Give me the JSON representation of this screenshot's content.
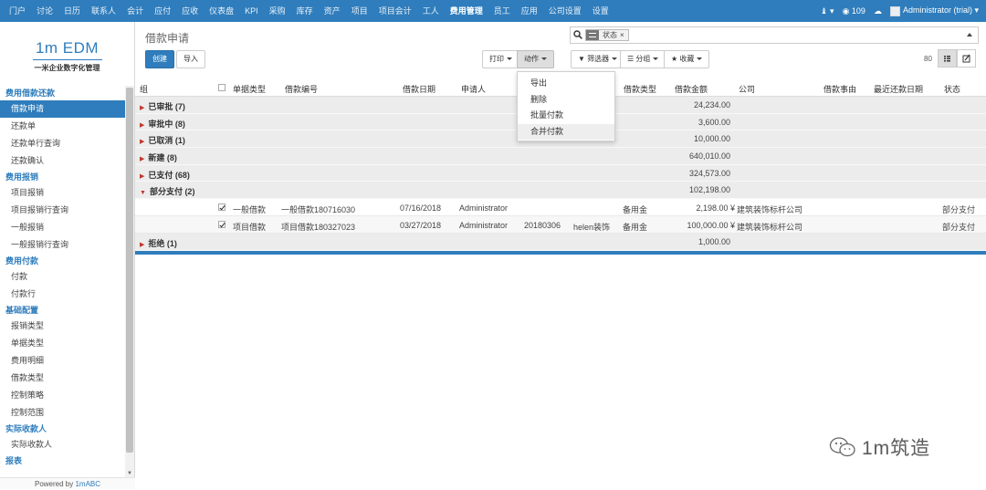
{
  "topnav": [
    "门户",
    "讨论",
    "日历",
    "联系人",
    "会计",
    "应付",
    "应收",
    "仪表盘",
    "KPI",
    "采购",
    "库存",
    "资产",
    "项目",
    "项目会计",
    "工人",
    "费用管理",
    "员工",
    "应用",
    "公司设置",
    "设置"
  ],
  "topnav_active_index": 15,
  "topright": {
    "notif_icon": "bell-icon",
    "message_count": "109",
    "user": "Administrator (trial)"
  },
  "logo": {
    "brand": "1m EDM",
    "tagline": "一米企业数字化管理"
  },
  "menu": [
    {
      "section": "费用借款还款",
      "items": [
        "借款申请",
        "还款单",
        "还款单行查询",
        "还款确认"
      ]
    },
    {
      "section": "费用报销",
      "items": [
        "项目报销",
        "项目报销行查询",
        "一般报销",
        "一般报销行查询"
      ]
    },
    {
      "section": "费用付款",
      "items": [
        "付款",
        "付款行"
      ]
    },
    {
      "section": "基础配置",
      "items": [
        "报销类型",
        "单据类型",
        "费用明细",
        "借款类型",
        "控制策略",
        "控制范围"
      ]
    },
    {
      "section": "实际收款人",
      "items": [
        "实际收款人"
      ]
    },
    {
      "section": "报表",
      "items": []
    }
  ],
  "menu_active": "借款申请",
  "powered": {
    "prefix": "Powered by ",
    "brand": "1mABC"
  },
  "page_title": "借款申请",
  "buttons": {
    "create": "创建",
    "import": "导入",
    "print": "打印",
    "action": "动作",
    "filters": "筛选器",
    "groupby": "分组",
    "favorites": "收藏"
  },
  "search": {
    "facet": "状态"
  },
  "pager": "80",
  "action_menu": [
    "导出",
    "删除",
    "批量付款",
    "合并付款"
  ],
  "action_menu_hover": 3,
  "columns": {
    "group": "组",
    "doc_type": "单据类型",
    "loan_no": "借款编号",
    "loan_date": "借款日期",
    "applicant": "申请人",
    "loan_type": "借款类型",
    "amount": "借款金额",
    "company": "公司",
    "reason": "借款事由",
    "repay_date": "最近还款日期",
    "status": "状态"
  },
  "groups": [
    {
      "label": "已审批 (7)",
      "amount": "24,234.00",
      "open": false
    },
    {
      "label": "审批中 (8)",
      "amount": "3,600.00",
      "open": false
    },
    {
      "label": "已取消 (1)",
      "amount": "10,000.00",
      "open": false
    },
    {
      "label": "新建 (8)",
      "amount": "640,010.00",
      "open": false
    },
    {
      "label": "已支付 (68)",
      "amount": "324,573.00",
      "open": false
    },
    {
      "label": "部分支付 (2)",
      "amount": "102,198.00",
      "open": true,
      "rows": [
        {
          "doc_type": "一般借款",
          "loan_no": "一般借款180716030",
          "date": "07/16/2018",
          "applicant": "Administrator",
          "code": "",
          "person": "",
          "loan_type": "备用金",
          "amount": "2,198.00 ¥",
          "company": "建筑装饰标杆公司",
          "status": "部分支付"
        },
        {
          "doc_type": "项目借款",
          "loan_no": "项目借款180327023",
          "date": "03/27/2018",
          "applicant": "Administrator",
          "code": "20180306",
          "person": "helen装饰",
          "loan_type": "备用金",
          "amount": "100,000.00 ¥",
          "company": "建筑装饰标杆公司",
          "status": "部分支付"
        }
      ]
    },
    {
      "label": "拒绝 (1)",
      "amount": "1,000.00",
      "open": false
    }
  ],
  "watermark": "1m筑造"
}
